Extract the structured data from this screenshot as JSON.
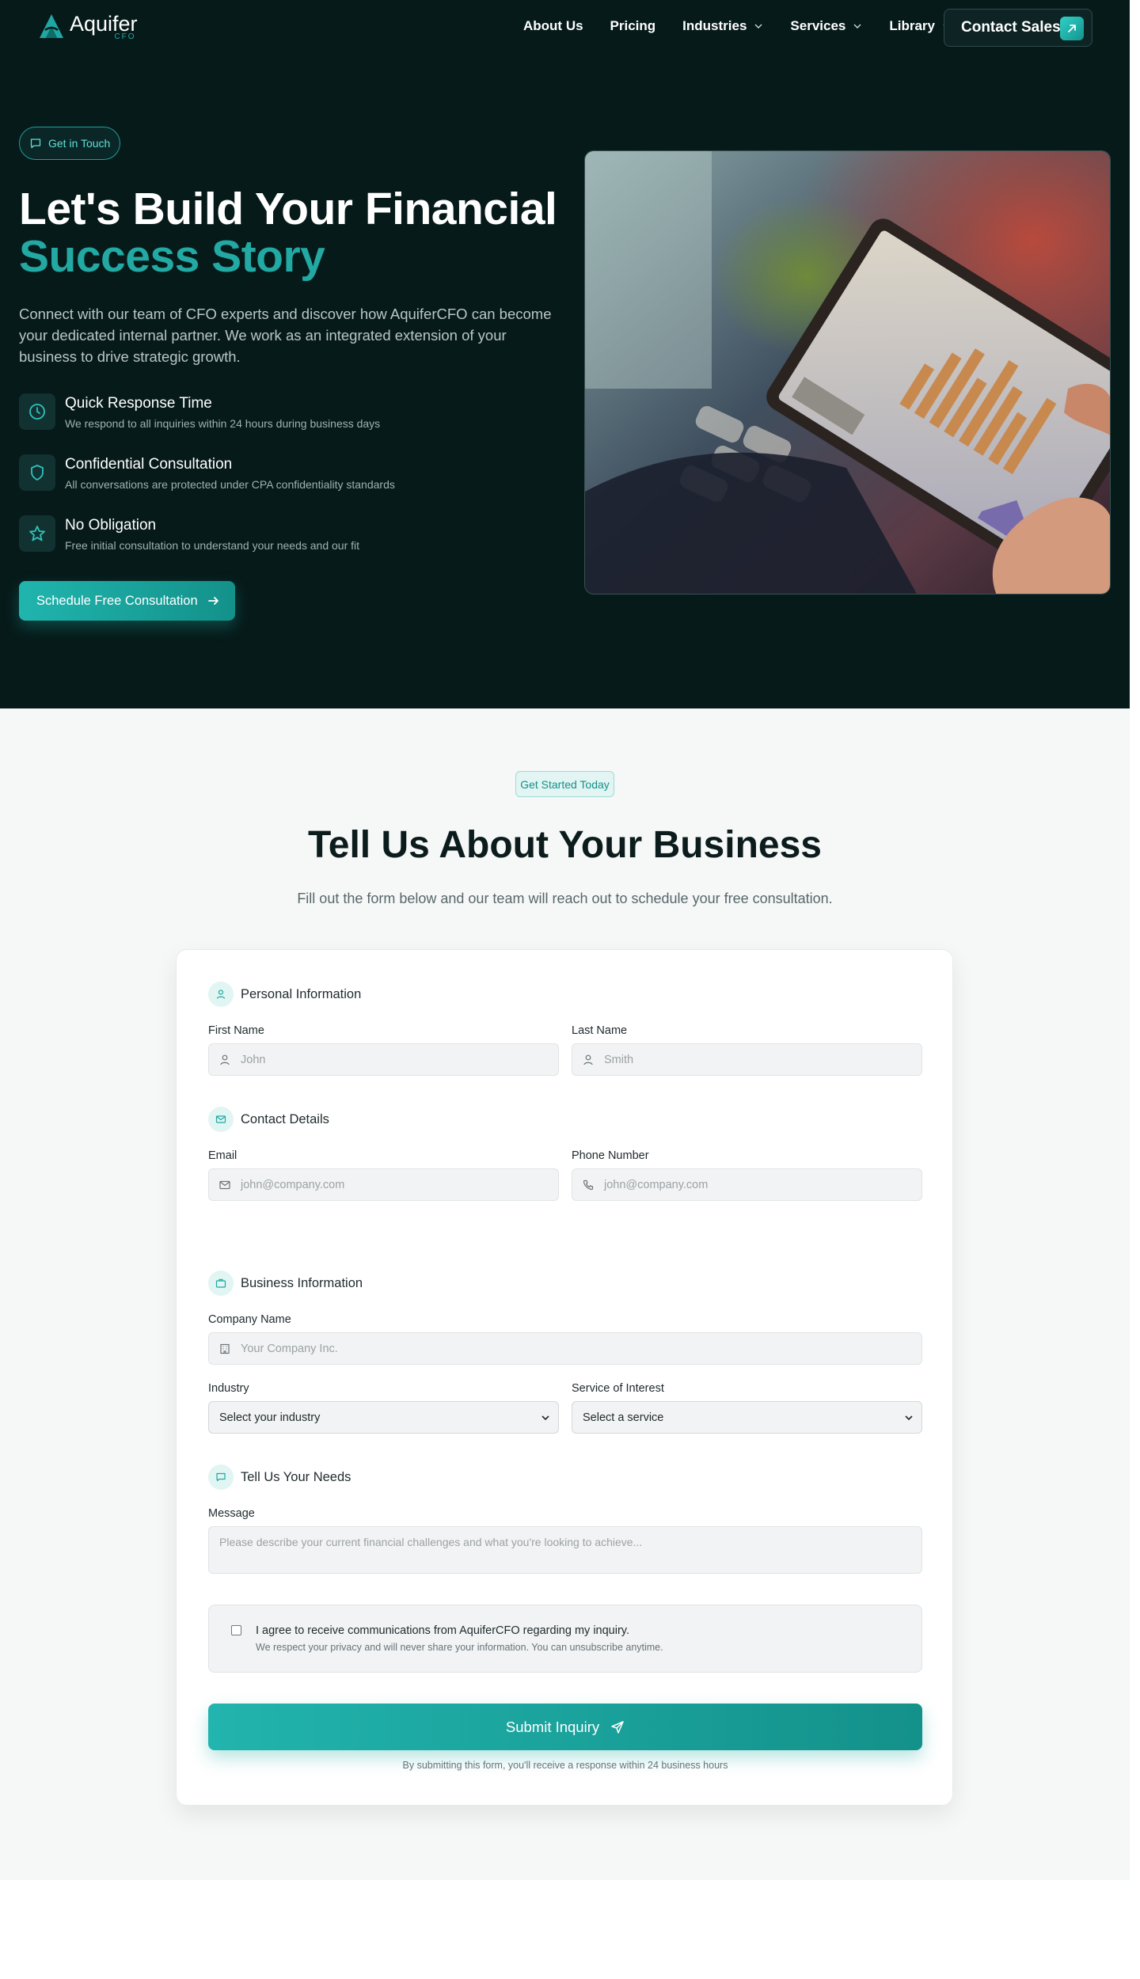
{
  "brand": {
    "name": "Aquifer",
    "sub": "CFO"
  },
  "nav": {
    "links": [
      "About Us",
      "Pricing",
      "Industries",
      "Services",
      "Library"
    ],
    "contact_label": "Contact Sales"
  },
  "hero": {
    "pill": "Get in Touch",
    "title_line1": "Let's Build Your Financial",
    "title_line2": "Success Story",
    "description": "Connect with our team of CFO experts and discover how AquiferCFO can become your dedicated internal partner. We work as an integrated extension of your business to drive strategic growth.",
    "features": [
      {
        "title": "Quick Response Time",
        "desc": "We respond to all inquiries within 24 hours during business days",
        "icon": "clock-icon"
      },
      {
        "title": "Confidential Consultation",
        "desc": "All conversations are protected under CPA confidentiality standards",
        "icon": "shield-icon"
      },
      {
        "title": "No Obligation",
        "desc": "Free initial consultation to understand your needs and our fit",
        "icon": "star-icon"
      }
    ],
    "cta": "Schedule Free Consultation"
  },
  "form_section": {
    "pill": "Get Started Today",
    "title": "Tell Us About Your Business",
    "subtitle": "Fill out the form below and our team will reach out to schedule your free consultation.",
    "personal": {
      "heading": "Personal Information",
      "first_label": "First Name",
      "first_placeholder": "John",
      "last_label": "Last Name",
      "last_placeholder": "Smith"
    },
    "contact": {
      "heading": "Contact Details",
      "email_label": "Email",
      "email_placeholder": "john@company.com",
      "phone_label": "Phone Number",
      "phone_placeholder": "john@company.com"
    },
    "business": {
      "heading": "Business Information",
      "company_label": "Company Name",
      "company_placeholder": "Your Company Inc.",
      "industry_label": "Industry",
      "industry_value": "Select your industry",
      "service_label": "Service of Interest",
      "service_value": "Select a service"
    },
    "needs": {
      "heading": "Tell Us Your Needs",
      "message_label": "Message",
      "message_placeholder": "Please describe your current financial challenges and what you're looking to achieve..."
    },
    "consent": {
      "text": "I agree to receive communications from AquiferCFO regarding my inquiry.",
      "sub": "We respect your privacy and will never share your information. You can unsubscribe anytime."
    },
    "submit_label": "Submit Inquiry",
    "submit_note": "By submitting this form, you'll receive a response within 24 business hours"
  },
  "colors": {
    "accent": "#1fa8a3",
    "dark": "#071a1a",
    "light_bg": "#f5f8f7"
  }
}
